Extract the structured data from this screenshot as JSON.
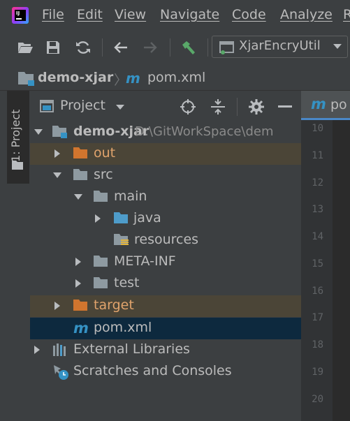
{
  "menu": [
    "File",
    "Edit",
    "View",
    "Navigate",
    "Code",
    "Analyze",
    "R"
  ],
  "toolbar": {
    "run_config": "XjarEncryUtil",
    "icons": [
      "open-folder-icon",
      "save-icon",
      "sync-icon",
      "back-arrow-icon",
      "forward-arrow-icon",
      "build-hammer-icon",
      "run-config-icon",
      "dropdown-caret-icon"
    ]
  },
  "breadcrumb": {
    "project": "demo-xjar",
    "separator": "〉",
    "file": "pom.xml"
  },
  "sidebar": {
    "project_tab_label": "1: Project"
  },
  "project_panel": {
    "title": "Project",
    "header_icons": [
      "locate-target-icon",
      "collapse-all-icon",
      "settings-gear-icon",
      "hide-minus-icon"
    ],
    "tree": [
      {
        "label": "demo-xjar",
        "path": "D:\\GitWorkSpace\\dem"
      },
      {
        "label": "out"
      },
      {
        "label": "src"
      },
      {
        "label": "main"
      },
      {
        "label": "java"
      },
      {
        "label": "resources"
      },
      {
        "label": "META-INF"
      },
      {
        "label": "test"
      },
      {
        "label": "target"
      },
      {
        "label": "pom.xml"
      },
      {
        "label": "External Libraries"
      },
      {
        "label": "Scratches and Consoles"
      }
    ]
  },
  "editor": {
    "tab_label": "po",
    "line_numbers": [
      "10",
      "11",
      "12",
      "13",
      "14",
      "15",
      "16",
      "17",
      "18",
      "19",
      "20"
    ]
  },
  "colors": {
    "background": "#3c3f41",
    "editor_background": "#2b2b2b",
    "gutter": "#313335",
    "selection": "#0d293e",
    "excluded_row": "#4b4537",
    "excluded_text": "#e0a36c",
    "folder_gray": "#8e9aa1",
    "folder_blue": "#4e9cca",
    "folder_orange": "#d1752e",
    "maven_blue": "#3592c4"
  }
}
